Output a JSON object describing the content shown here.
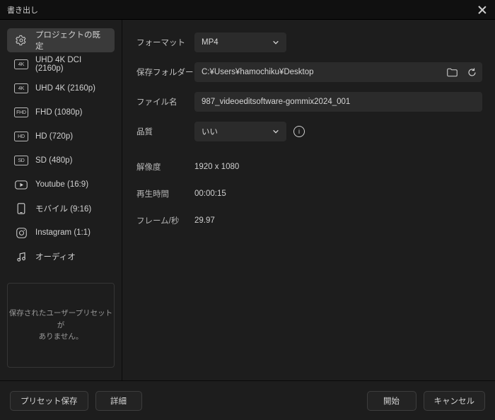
{
  "window": {
    "title": "書き出し"
  },
  "sidebar": {
    "items": [
      {
        "badge": "",
        "label": "プロジェクトの既定"
      },
      {
        "badge": "4K",
        "label": "UHD 4K DCI (2160p)"
      },
      {
        "badge": "4K",
        "label": "UHD 4K (2160p)"
      },
      {
        "badge": "FHD",
        "label": "FHD (1080p)"
      },
      {
        "badge": "HD",
        "label": "HD (720p)"
      },
      {
        "badge": "SD",
        "label": "SD (480p)"
      },
      {
        "badge": "ico",
        "label": "Youtube (16:9)"
      },
      {
        "badge": "ico",
        "label": "モバイル (9:16)"
      },
      {
        "badge": "ico",
        "label": "Instagram (1:1)"
      },
      {
        "badge": "ico",
        "label": "オーディオ"
      }
    ],
    "user_preset_empty": "保存されたユーザープリセットが\nありません。"
  },
  "form": {
    "format": {
      "label": "フォーマット",
      "value": "MP4"
    },
    "folder": {
      "label": "保存フォルダー",
      "value": "C:¥Users¥hamochiku¥Desktop"
    },
    "filename": {
      "label": "ファイル名",
      "value": "987_videoeditsoftware-gommix2024_001"
    },
    "quality": {
      "label": "品質",
      "value": "いい"
    }
  },
  "meta": {
    "resolution": {
      "label": "解像度",
      "value": "1920  x  1080"
    },
    "duration": {
      "label": "再生時間",
      "value": "00:00:15"
    },
    "fps": {
      "label": "フレーム/秒",
      "value": "29.97"
    }
  },
  "footer": {
    "save_preset": "プリセット保存",
    "detail": "詳細",
    "start": "開始",
    "cancel": "キャンセル"
  }
}
